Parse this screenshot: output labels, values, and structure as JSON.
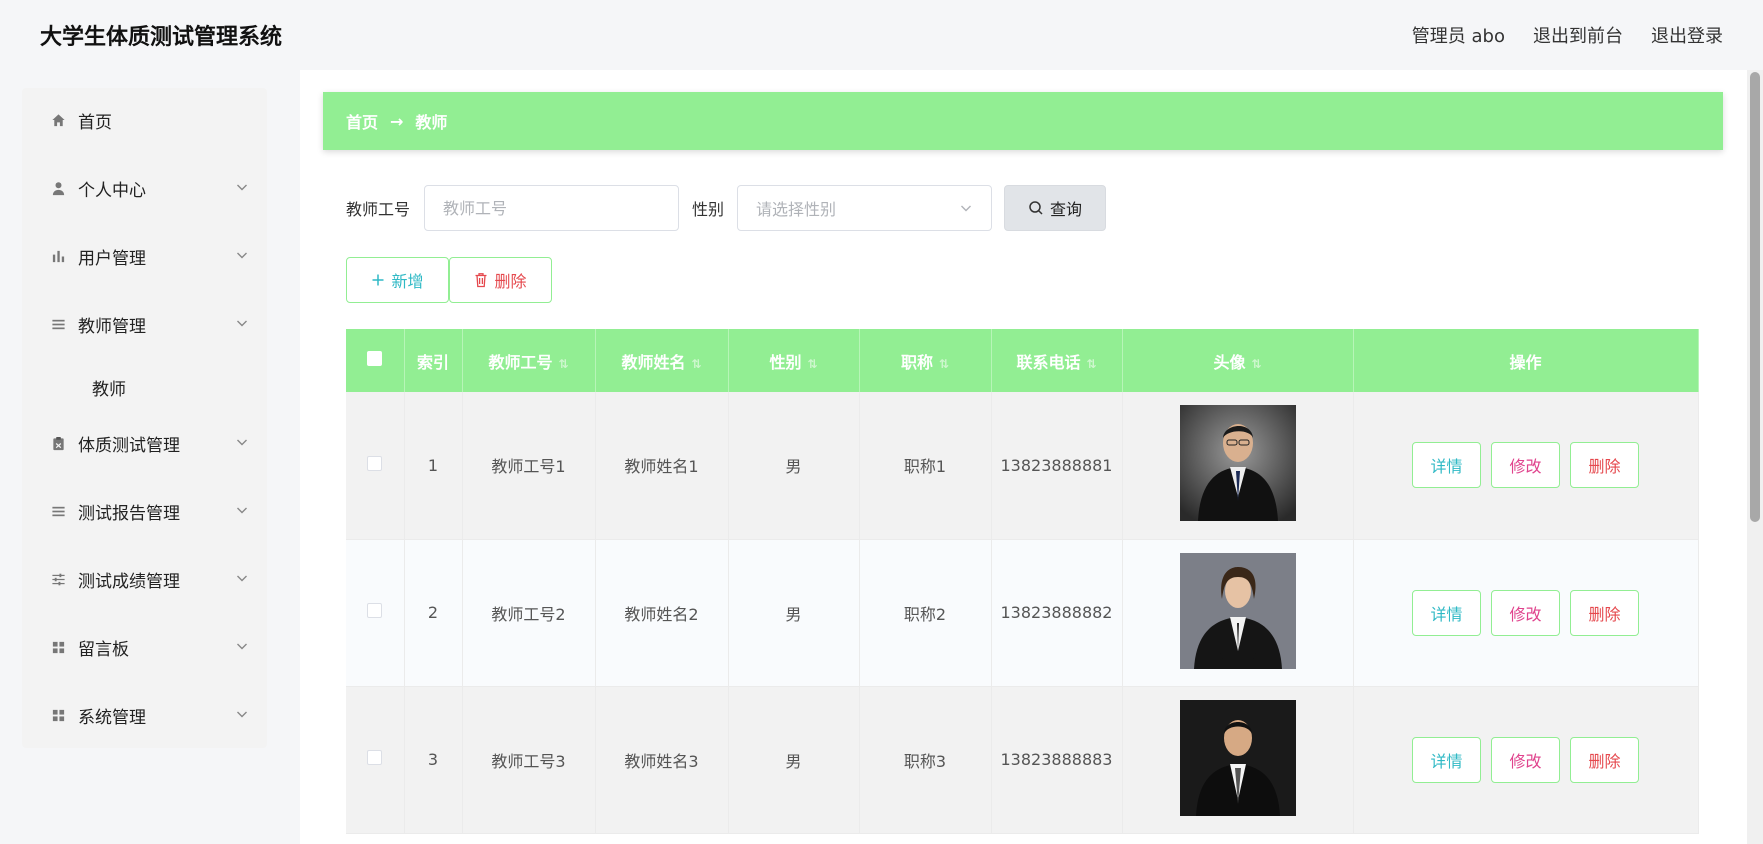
{
  "app": {
    "title": "大学生体质测试管理系统",
    "user_label": "管理员 abo",
    "front_link": "退出到前台",
    "logout_link": "退出登录"
  },
  "sidebar": {
    "items": [
      {
        "label": "首页",
        "icon": "home-icon"
      },
      {
        "label": "个人中心",
        "icon": "user-icon"
      },
      {
        "label": "用户管理",
        "icon": "bar-chart-icon"
      },
      {
        "label": "教师管理",
        "icon": "list-icon"
      },
      {
        "label": "体质测试管理",
        "icon": "clipboard-icon"
      },
      {
        "label": "测试报告管理",
        "icon": "list-icon"
      },
      {
        "label": "测试成绩管理",
        "icon": "sliders-icon"
      },
      {
        "label": "留言板",
        "icon": "grid-icon"
      },
      {
        "label": "系统管理",
        "icon": "grid-icon"
      }
    ],
    "sub_item": "教师"
  },
  "breadcrumb": {
    "home": "首页",
    "arrow": "→",
    "current": "教师"
  },
  "search": {
    "id_label": "教师工号",
    "id_placeholder": "教师工号",
    "gender_label": "性别",
    "gender_placeholder": "请选择性别",
    "query_label": "查询"
  },
  "actions": {
    "add_label": "新增",
    "delete_label": "删除"
  },
  "table": {
    "headers": [
      "索引",
      "教师工号",
      "教师姓名",
      "性别",
      "职称",
      "联系电话",
      "头像",
      "操作"
    ],
    "rows": [
      {
        "index": "1",
        "id": "教师工号1",
        "name": "教师姓名1",
        "gender": "男",
        "title": "职称1",
        "phone": "13823888881"
      },
      {
        "index": "2",
        "id": "教师工号2",
        "name": "教师姓名2",
        "gender": "男",
        "title": "职称2",
        "phone": "13823888882"
      },
      {
        "index": "3",
        "id": "教师工号3",
        "name": "教师姓名3",
        "gender": "男",
        "title": "职称3",
        "phone": "13823888883"
      }
    ],
    "op_detail": "详情",
    "op_edit": "修改",
    "op_delete": "删除"
  },
  "colors": {
    "accent": "#92ee93",
    "detail": "#2fb9c5",
    "edit": "#e0438d",
    "delete": "#e5484d"
  }
}
